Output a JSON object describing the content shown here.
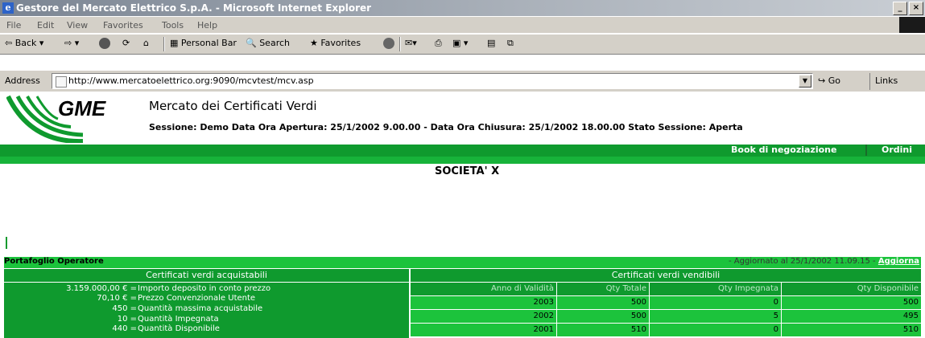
{
  "window": {
    "title": "Gestore del Mercato Elettrico S.p.A. - Microsoft Internet Explorer",
    "buttons": [
      "_",
      "×"
    ]
  },
  "menu": [
    "File",
    "Edit",
    "View",
    "Favorites",
    "Tools",
    "Help"
  ],
  "toolbar": {
    "back": "Back",
    "personal_bar": "Personal Bar",
    "search": "Search",
    "favorites": "Favorites"
  },
  "address": {
    "label": "Address",
    "url": "http://www.mercatoelettrico.org:9090/mcvtest/mcv.asp",
    "go": "Go",
    "links": "Links"
  },
  "site": {
    "logo_text": "GME",
    "title": "Mercato dei Certificati Verdi",
    "session": "Sessione: Demo Data Ora Apertura: 25/1/2002 9.00.00 - Data Ora Chiusura: 25/1/2002 18.00.00 Stato Sessione: Aperta",
    "nav": [
      "Book di negoziazione",
      "Ordini"
    ],
    "company": "SOCIETA' X"
  },
  "portfolio": {
    "title": "Portafoglio Operatore",
    "updated": "- Aggiornato al 25/1/2002 11.09.15 - ",
    "refresh": "Aggiorna",
    "left_header": "Certificati verdi acquistabili",
    "right_header": "Certificati verdi vendibili",
    "left_rows": [
      {
        "value": "3.159.000,00 € =",
        "desc": "Importo deposito in conto prezzo"
      },
      {
        "value": "70,10 € =",
        "desc": "Prezzo Convenzionale Utente"
      },
      {
        "value": "450 =",
        "desc": "Quantità massima acquistabile"
      },
      {
        "value": "10 =",
        "desc": "Quantità Impegnata"
      },
      {
        "value": "440 =",
        "desc": "Quantità Disponibile"
      }
    ],
    "grid_headers": [
      "Anno di Validità",
      "Qty Totale",
      "Qty Impegnata",
      "Qty Disponibile"
    ],
    "grid_rows": [
      [
        "2003",
        "500",
        "0",
        "500"
      ],
      [
        "2002",
        "500",
        "5",
        "495"
      ],
      [
        "2001",
        "510",
        "0",
        "510"
      ]
    ]
  },
  "colors": {
    "green_dark": "#0f9a2e",
    "green_light": "#1cc33c"
  }
}
